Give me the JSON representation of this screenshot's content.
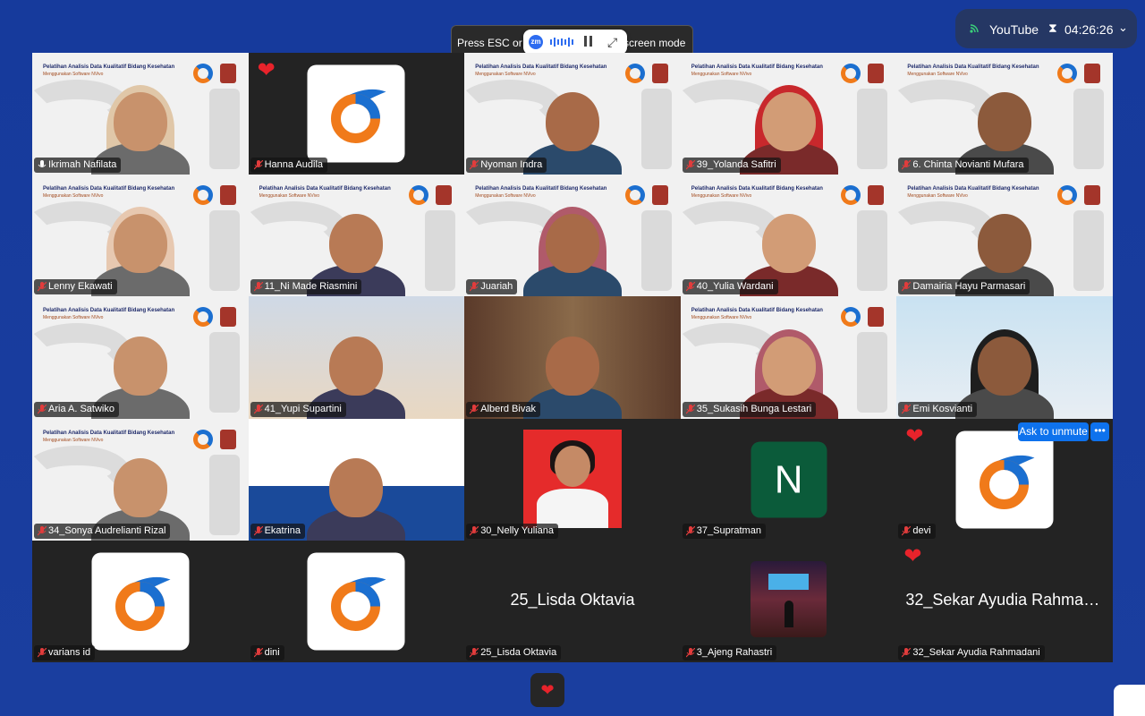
{
  "banner": {
    "left_text": "Press ESC or c",
    "right_text": "screen mode",
    "zm_logo": "zm",
    "pause_icon": "pause-icon",
    "expand_icon": "expand-icon"
  },
  "stream": {
    "service": "YouTube",
    "elapsed": "04:26:26",
    "live_icon": "live-broadcast-icon",
    "timer_icon": "hourglass-icon",
    "chevron_icon": "chevron-down-icon"
  },
  "background_banner": {
    "title": "Pelatihan Analisis Data Kualitatif Bidang Kesehatan",
    "subtitle": "Menggunakan Software NVivo"
  },
  "participants": [
    {
      "name": "Ikrimah Nafilata",
      "type": "video",
      "active": true
    },
    {
      "name": "Hanna Audila",
      "type": "logo",
      "reaction": "heart"
    },
    {
      "name": "Nyoman Indra",
      "type": "video"
    },
    {
      "name": "39_Yolanda Safitri",
      "type": "video"
    },
    {
      "name": "6. Chinta Novianti Mufara",
      "type": "video"
    },
    {
      "name": "Lenny Ekawati",
      "type": "video"
    },
    {
      "name": "11_Ni Made Riasmini",
      "type": "video"
    },
    {
      "name": "Juariah",
      "type": "video"
    },
    {
      "name": "40_Yulia Wardani",
      "type": "video"
    },
    {
      "name": "Damairia Hayu Parmasari",
      "type": "video"
    },
    {
      "name": "Aria A. Satwiko",
      "type": "video"
    },
    {
      "name": "41_Yupi Supartini",
      "type": "video"
    },
    {
      "name": "Alberd Bivak",
      "type": "video"
    },
    {
      "name": "35_Sukasih Bunga Lestari",
      "type": "video"
    },
    {
      "name": "Emi Kosvianti",
      "type": "video"
    },
    {
      "name": "34_Sonya Audrelianti Rizal",
      "type": "video"
    },
    {
      "name": "Ekatrina",
      "type": "video"
    },
    {
      "name": "30_Nelly Yuliana",
      "type": "photo"
    },
    {
      "name": "37_Supratman",
      "type": "initial",
      "initial": "N"
    },
    {
      "name": "devi",
      "type": "logo",
      "reaction": "heart"
    },
    {
      "name": "varians id",
      "type": "logo"
    },
    {
      "name": "dini",
      "type": "logo"
    },
    {
      "name": "25_Lisda Oktavia",
      "type": "name",
      "display": "25_Lisda Oktavia"
    },
    {
      "name": "3_Ajeng Rahastri",
      "type": "photo"
    },
    {
      "name": "32_Sekar Ayudia Rahmadani",
      "type": "name",
      "display": "32_Sekar Ayudia Rahmad...",
      "reaction": "heart"
    }
  ],
  "controls": {
    "ask_to_unmute": "Ask to unmute",
    "more": "•••",
    "reaction_icon": "heart-icon"
  },
  "colors": {
    "background": "#17399a",
    "active_speaker": "#23d959",
    "ask_unmute_blue": "#0e72ed",
    "heart": "#e8232b"
  }
}
